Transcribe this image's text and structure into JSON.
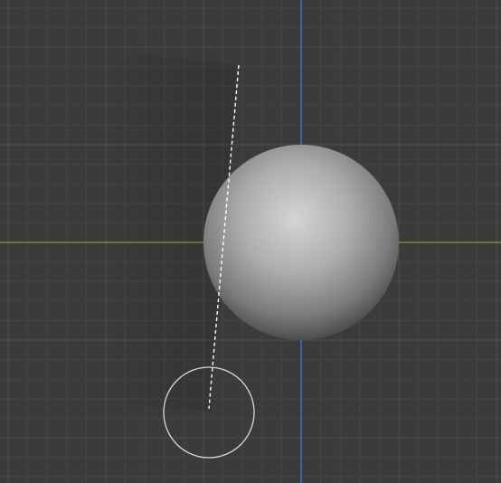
{
  "viewport": {
    "view": "top",
    "colors": {
      "background": "#3b3b3b",
      "grid_minor": "#454545",
      "grid_major": "#4e4e4e",
      "axis_x": "#6f8f2c",
      "axis_y": "#3f6ec0",
      "sphere_light": "#d4d4d4",
      "sphere_dark": "#4c4e4e",
      "gizmo": "#d8d8d8"
    },
    "objects": [
      {
        "type": "uv-sphere",
        "shading": "solid",
        "selected": false
      }
    ],
    "tool": {
      "name": "brush-cursor-icon",
      "stroke": "dashed-line"
    }
  }
}
